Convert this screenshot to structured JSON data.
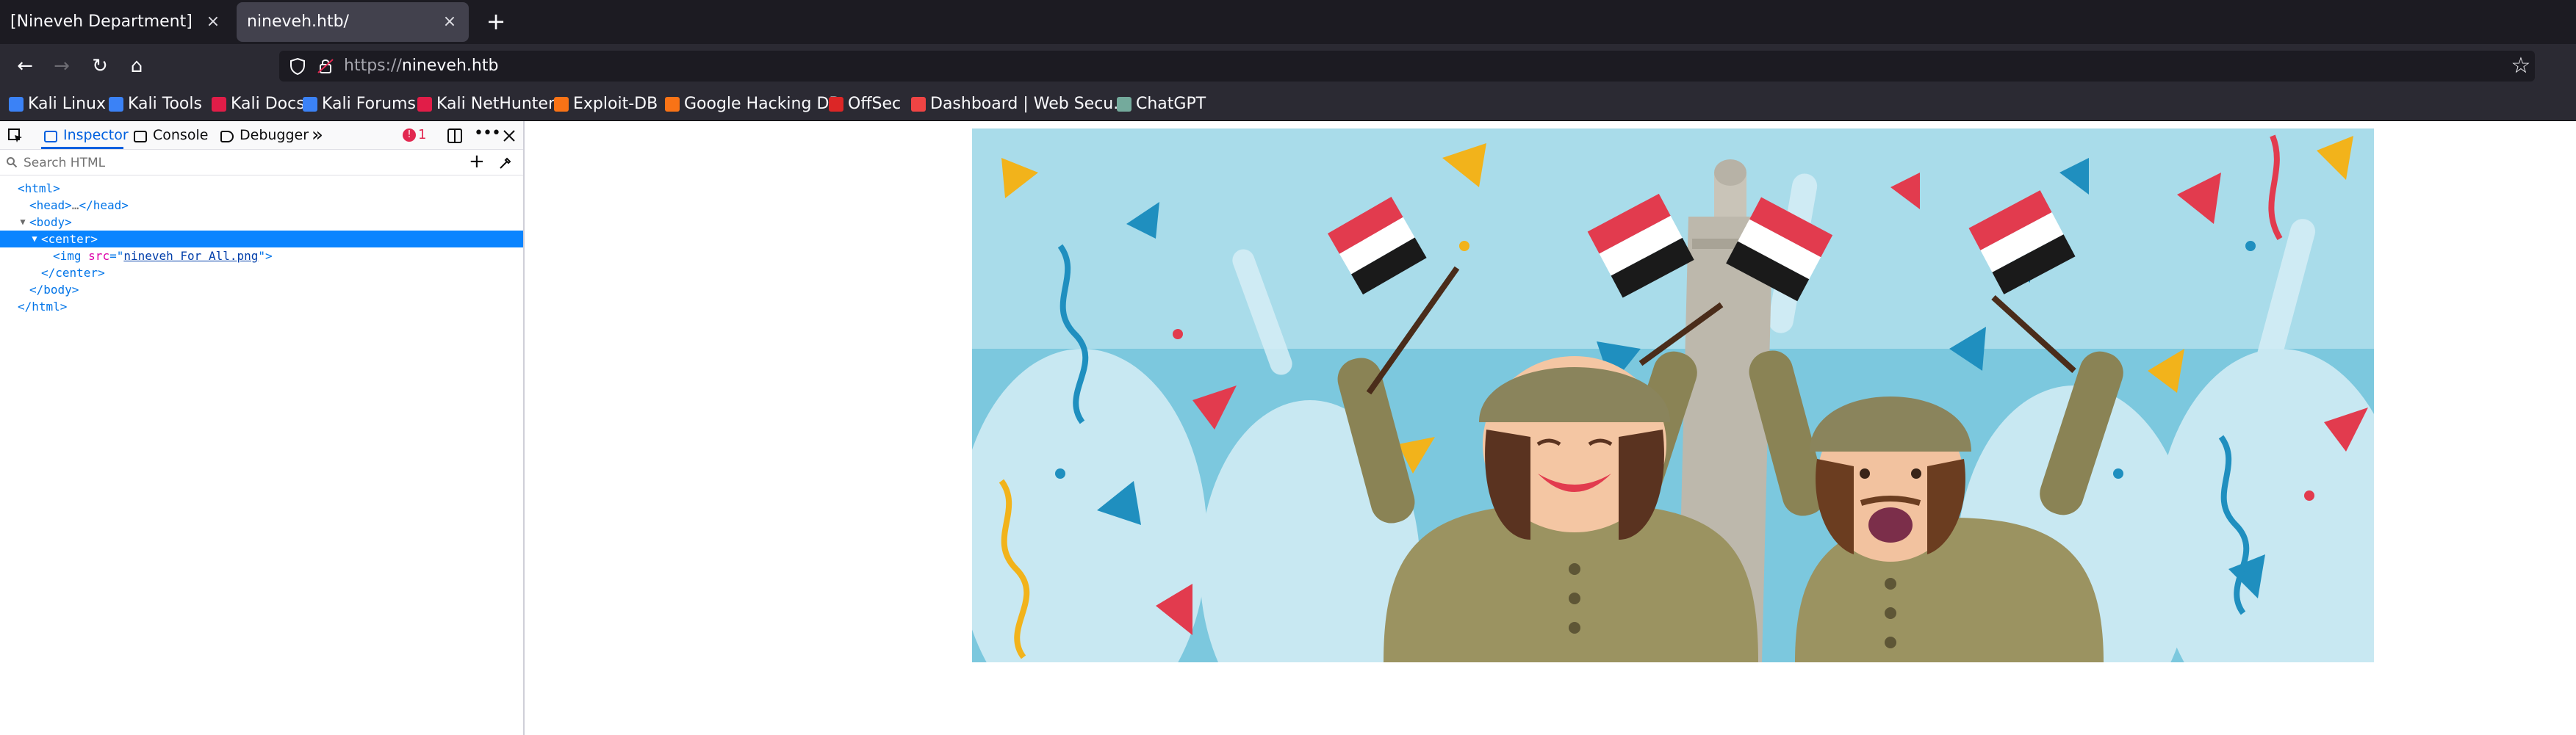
{
  "tabs": [
    {
      "label": "[Nineveh Department]",
      "close": "×"
    },
    {
      "label": "nineveh.htb/",
      "close": "×"
    }
  ],
  "new_tab": "+",
  "nav": {
    "back": "←",
    "forward": "→",
    "reload": "↻",
    "home": "⌂",
    "url_scheme": "https://",
    "url_host": "nineveh.htb",
    "star": "☆"
  },
  "bookmarks": [
    {
      "label": "Kali Linux",
      "color": "#3b82f6"
    },
    {
      "label": "Kali Tools",
      "color": "#3b82f6"
    },
    {
      "label": "Kali Docs",
      "color": "#e11d48"
    },
    {
      "label": "Kali Forums",
      "color": "#3b82f6"
    },
    {
      "label": "Kali NetHunter",
      "color": "#e11d48"
    },
    {
      "label": "Exploit-DB",
      "color": "#f97316"
    },
    {
      "label": "Google Hacking DB",
      "color": "#f97316"
    },
    {
      "label": "OffSec",
      "color": "#dc2626"
    },
    {
      "label": "Dashboard | Web Secu...",
      "color": "#ef4444"
    },
    {
      "label": "ChatGPT",
      "color": "#74aa9c"
    }
  ],
  "devtools": {
    "tabs": [
      "Inspector",
      "Console",
      "Debugger"
    ],
    "more": "»",
    "error_count": "1",
    "search_placeholder": "Search HTML",
    "add": "+",
    "markup": {
      "html_open": "<html>",
      "head": "<head>",
      "head_ellipsis": "…",
      "head_close": "</head>",
      "body_open": "<body>",
      "center_open": "<center>",
      "img_tag": "<img",
      "img_attr": "src",
      "img_eq": "=\"",
      "img_src": "nineveh For All.png",
      "img_end": "\">",
      "center_close": "</center>",
      "body_close": "</body>",
      "html_close": "</html>"
    }
  },
  "colors": {
    "chrome_dark": "#1c1b22",
    "chrome": "#2b2a33",
    "selection": "#0a84ff",
    "accent": "#0060df"
  }
}
